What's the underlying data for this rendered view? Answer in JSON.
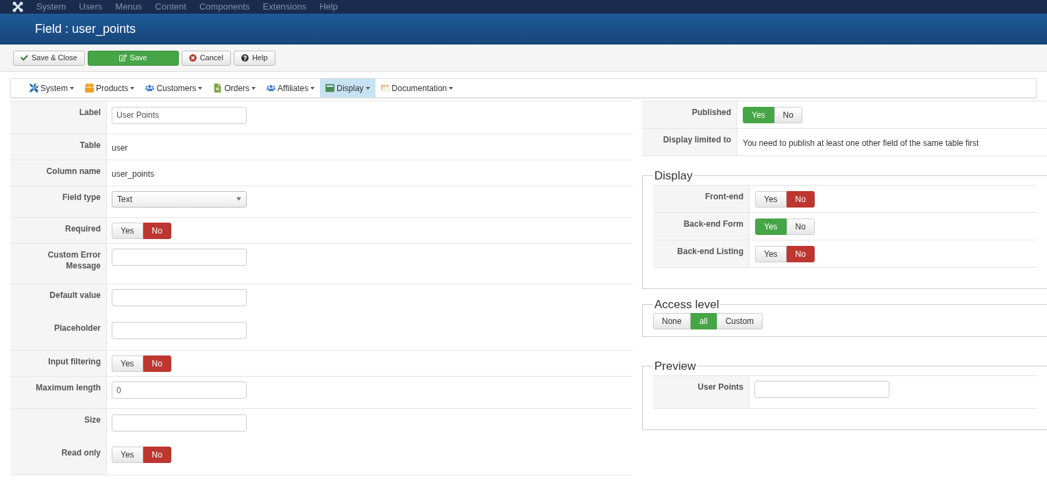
{
  "top_menu": [
    "System",
    "Users",
    "Menus",
    "Content",
    "Components",
    "Extensions",
    "Help"
  ],
  "page_title": "Field : user_points",
  "toolbar": [
    {
      "kind": "check",
      "label": "Save & Close"
    },
    {
      "kind": "save",
      "label": "Save"
    },
    {
      "kind": "cancel",
      "label": "Cancel"
    },
    {
      "kind": "help",
      "label": "Help"
    }
  ],
  "submenu": [
    {
      "kind": "tools",
      "label": "System",
      "selected": false
    },
    {
      "kind": "box",
      "label": "Products",
      "selected": false
    },
    {
      "kind": "people",
      "label": "Customers",
      "selected": false
    },
    {
      "kind": "doc",
      "label": "Orders",
      "selected": false
    },
    {
      "kind": "people",
      "label": "Affiliates",
      "selected": false
    },
    {
      "kind": "window",
      "label": "Display",
      "selected": true
    },
    {
      "kind": "dots",
      "label": "Documentation",
      "selected": false
    }
  ],
  "form": [
    [
      {
        "kind": "input",
        "label": "Label",
        "value": "User Points"
      }
    ],
    [
      {
        "kind": "text",
        "label": "Table",
        "value": "user"
      }
    ],
    [
      {
        "kind": "text",
        "label": "Column name",
        "value": "user_points"
      }
    ],
    [
      {
        "kind": "select",
        "label": "Field type",
        "value": "Text"
      }
    ],
    [
      {
        "kind": "toggle",
        "label": "Required",
        "options": [
          {
            "label": "Yes",
            "selected": false
          },
          {
            "label": "No",
            "color": "#bd362f",
            "selected": true
          }
        ]
      }
    ],
    [
      {
        "kind": "input",
        "label": "Custom Error Message"
      }
    ],
    [
      {
        "kind": "input",
        "label": "Default value"
      },
      {
        "kind": "input",
        "label": "Placeholder"
      }
    ],
    [
      {
        "kind": "toggle",
        "label": "Input filtering",
        "options": [
          {
            "label": "Yes",
            "selected": false
          },
          {
            "label": "No",
            "color": "#bd362f",
            "selected": true
          }
        ]
      }
    ],
    [
      {
        "kind": "input",
        "label": "Maximum length",
        "value": "0"
      }
    ],
    [
      {
        "kind": "input",
        "label": "Size"
      },
      {
        "kind": "toggle",
        "label": "Read only",
        "options": [
          {
            "label": "Yes",
            "selected": false
          },
          {
            "label": "No",
            "color": "#bd362f",
            "selected": true
          }
        ]
      }
    ]
  ],
  "side_form": [
    {
      "kind": "toggle",
      "label": "Published",
      "options": [
        {
          "label": "Yes",
          "color": "#46a546",
          "selected": true
        },
        {
          "label": "No",
          "selected": false
        }
      ]
    },
    {
      "kind": "text",
      "label": "Display limited to",
      "value": "You need to publish at least one other field of the same table first"
    }
  ],
  "display": {
    "title": "Display",
    "rows": [
      {
        "kind": "toggle",
        "label": "Front-end",
        "options": [
          {
            "label": "Yes",
            "selected": false
          },
          {
            "label": "No",
            "color": "#bd362f",
            "selected": true
          }
        ]
      },
      {
        "kind": "toggle",
        "label": "Back-end Form",
        "options": [
          {
            "label": "Yes",
            "color": "#46a546",
            "selected": true
          },
          {
            "label": "No",
            "selected": false
          }
        ]
      },
      {
        "kind": "toggle",
        "label": "Back-end Listing",
        "options": [
          {
            "label": "Yes",
            "selected": false
          },
          {
            "label": "No",
            "color": "#bd362f",
            "selected": true
          }
        ]
      }
    ]
  },
  "access_level": {
    "title": "Access level",
    "options": [
      {
        "label": "None",
        "selected": false
      },
      {
        "label": "all",
        "color": "#46a546",
        "selected": true
      },
      {
        "label": "Custom",
        "selected": false
      }
    ]
  },
  "preview": {
    "title": "Preview",
    "rows": [
      {
        "kind": "input",
        "label": "User Points"
      }
    ]
  }
}
